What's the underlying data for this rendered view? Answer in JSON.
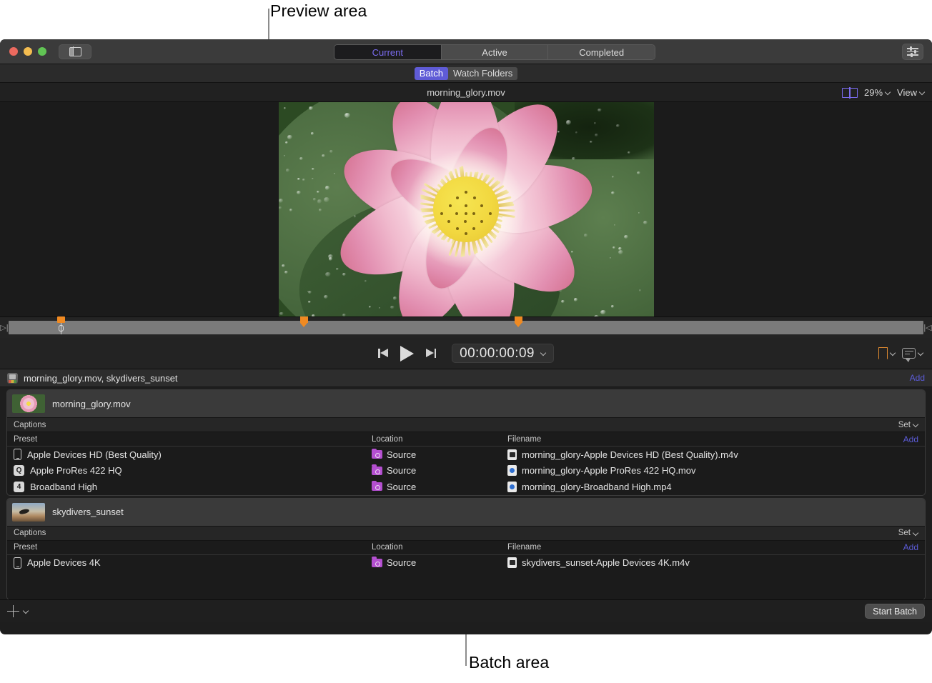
{
  "annotations": {
    "preview": "Preview area",
    "batch": "Batch area"
  },
  "window": {
    "titlebar": {
      "sidebar_toggle": "sidebar-toggle",
      "settings": "settings",
      "segments": [
        {
          "label": "Current",
          "selected": true
        },
        {
          "label": "Active",
          "selected": false
        },
        {
          "label": "Completed",
          "selected": false
        }
      ]
    },
    "subtabs": [
      {
        "label": "Batch",
        "selected": true
      },
      {
        "label": "Watch Folders",
        "selected": false
      }
    ],
    "preview": {
      "title": "morning_glory.mov",
      "zoom": "29%",
      "view": "View",
      "timecode": "00:00:00:09"
    },
    "batch": {
      "header_title": "morning_glory.mov, skydivers_sunset",
      "header_add": "Add",
      "captions_label": "Captions",
      "set_label": "Set",
      "add_label": "Add",
      "columns": {
        "preset": "Preset",
        "location": "Location",
        "filename": "Filename"
      },
      "jobs": [
        {
          "name": "morning_glory.mov",
          "thumb": "flower",
          "rows": [
            {
              "icon": "phone",
              "preset": "Apple Devices HD (Best Quality)",
              "location": "Source",
              "file_icon": "m4v",
              "filename": "morning_glory-Apple Devices HD (Best Quality).m4v"
            },
            {
              "icon": "prores",
              "preset": "Apple ProRes 422 HQ",
              "location": "Source",
              "file_icon": "blue",
              "filename": "morning_glory-Apple ProRes 422 HQ.mov"
            },
            {
              "icon": "four",
              "preset": "Broadband High",
              "location": "Source",
              "file_icon": "blue",
              "filename": "morning_glory-Broadband High.mp4"
            }
          ]
        },
        {
          "name": "skydivers_sunset",
          "thumb": "sky",
          "rows": [
            {
              "icon": "phone",
              "preset": "Apple Devices 4K",
              "location": "Source",
              "file_icon": "m4v",
              "filename": "skydivers_sunset-Apple Devices 4K.m4v"
            }
          ]
        }
      ]
    },
    "bottom": {
      "add_menu": "+",
      "start_batch": "Start Batch"
    }
  },
  "colors": {
    "accent_purple": "#5f5bd6",
    "link_blue": "#5b5bd6",
    "marker_orange": "#f08a22",
    "folder_purple": "#b44fd0",
    "window_bg": "#1e1e1e"
  }
}
